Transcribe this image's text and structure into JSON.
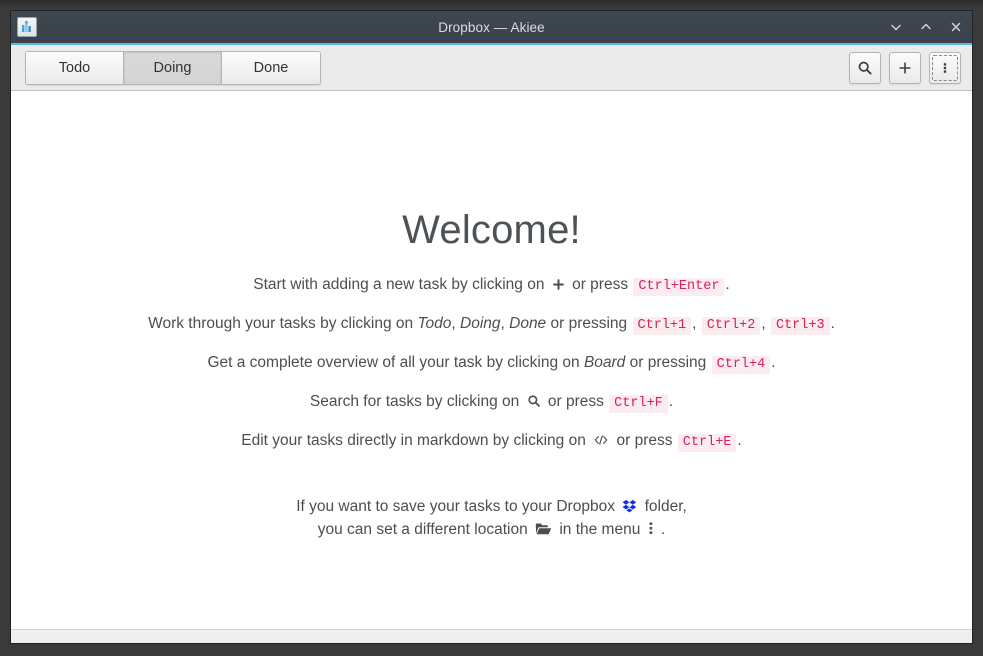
{
  "window": {
    "title": "Dropbox — Akiee",
    "app_icon": "akiee-app-icon",
    "controls": [
      {
        "name": "minimize-button",
        "icon": "chevron-down-icon"
      },
      {
        "name": "maximize-button",
        "icon": "chevron-up-icon"
      },
      {
        "name": "close-button",
        "icon": "close-icon"
      }
    ]
  },
  "toolbar": {
    "tabs": [
      {
        "label": "Todo",
        "active": false
      },
      {
        "label": "Doing",
        "active": true
      },
      {
        "label": "Done",
        "active": false
      }
    ],
    "buttons": [
      {
        "name": "search-button",
        "icon": "search-icon",
        "label": ""
      },
      {
        "name": "add-task-button",
        "icon": "plus-icon",
        "label": "+"
      },
      {
        "name": "menu-button",
        "icon": "kebab-menu-icon",
        "label": "",
        "focused": true
      }
    ]
  },
  "content": {
    "title": "Welcome!",
    "lines": {
      "line1": {
        "pre": "Start with adding a new task by clicking on",
        "icon": "plus-icon",
        "mid": "or press",
        "kbd": "Ctrl+Enter",
        "post": "."
      },
      "line2": {
        "pre": "Work through your tasks by clicking on",
        "emph1": "Todo",
        "sep1": ",",
        "emph2": "Doing",
        "sep2": ",",
        "emph3": "Done",
        "mid": "or pressing",
        "kbd1": "Ctrl+1",
        "comma1": ",",
        "kbd2": "Ctrl+2",
        "comma2": ",",
        "kbd3": "Ctrl+3",
        "post": "."
      },
      "line3": {
        "pre": "Get a complete overview of all your task by clicking on",
        "emph": "Board",
        "mid": "or pressing",
        "kbd": "Ctrl+4",
        "post": "."
      },
      "line4": {
        "pre": "Search for tasks by clicking on",
        "icon": "search-icon",
        "mid": "or press",
        "kbd": "Ctrl+F",
        "post": "."
      },
      "line5": {
        "pre": "Edit your tasks directly in markdown by clicking on",
        "icon": "code-brackets-icon",
        "mid": "or press",
        "kbd": "Ctrl+E",
        "post": "."
      }
    },
    "dropbox": {
      "line1_pre": "If you want to save your tasks to your Dropbox",
      "line1_icon": "dropbox-icon",
      "line1_post": "folder,",
      "line2_pre": "you can set a different location",
      "line2_icon": "open-folder-icon",
      "line2_mid": "in the menu",
      "line2_icon2": "kebab-menu-icon",
      "line2_post": "."
    }
  },
  "colors": {
    "titlebar": "#3c444d",
    "titlebar_accent": "#5ab8e6",
    "toolbar": "#ebebeb",
    "kbd_text": "#d6215b",
    "kbd_bg": "#fbecf0",
    "dropbox_blue": "#1a30e8",
    "text": "#4a4f53"
  }
}
